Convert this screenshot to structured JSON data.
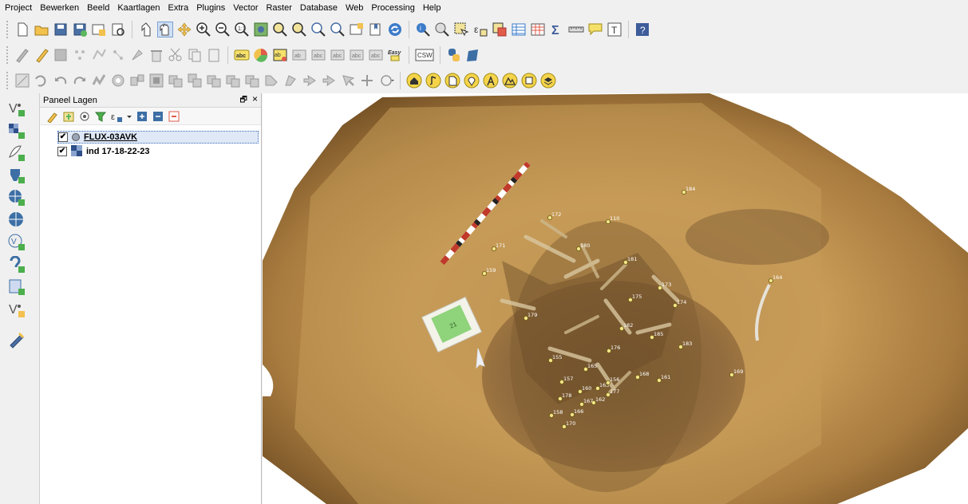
{
  "menu": [
    "Project",
    "Bewerken",
    "Beeld",
    "Kaartlagen",
    "Extra",
    "Plugins",
    "Vector",
    "Raster",
    "Database",
    "Web",
    "Processing",
    "Help"
  ],
  "toolbar_row3_labels": {
    "abc1": "abc",
    "easy": "Easy",
    "csw": "CSW",
    "sigma": "Σ",
    "text_tool": "T"
  },
  "layers_panel": {
    "title": "Paneel Lagen",
    "float_icon": "🗗",
    "close_icon": "×",
    "layers": [
      {
        "name": "FLUX-03AVK",
        "checked": true,
        "selected": true,
        "icon": "point-layer-icon"
      },
      {
        "name": "ind 17-18-22-23",
        "checked": true,
        "selected": false,
        "icon": "raster-layer-icon"
      }
    ]
  },
  "map": {
    "scale_card_text": "21",
    "markers": [
      "184",
      "172",
      "110",
      "171",
      "180",
      "181",
      "159",
      "173",
      "175",
      "174",
      "164",
      "179",
      "182",
      "185",
      "183",
      "176",
      "155",
      "165",
      "157",
      "163",
      "156",
      "160",
      "177",
      "162",
      "167",
      "178",
      "166",
      "158",
      "170",
      "168",
      "161",
      "169"
    ]
  },
  "colors": {
    "soil_dark": "#7a5a2c",
    "soil_light": "#c79a55",
    "marker_fill": "#f3e48a",
    "selection": "#dfe8f6"
  }
}
